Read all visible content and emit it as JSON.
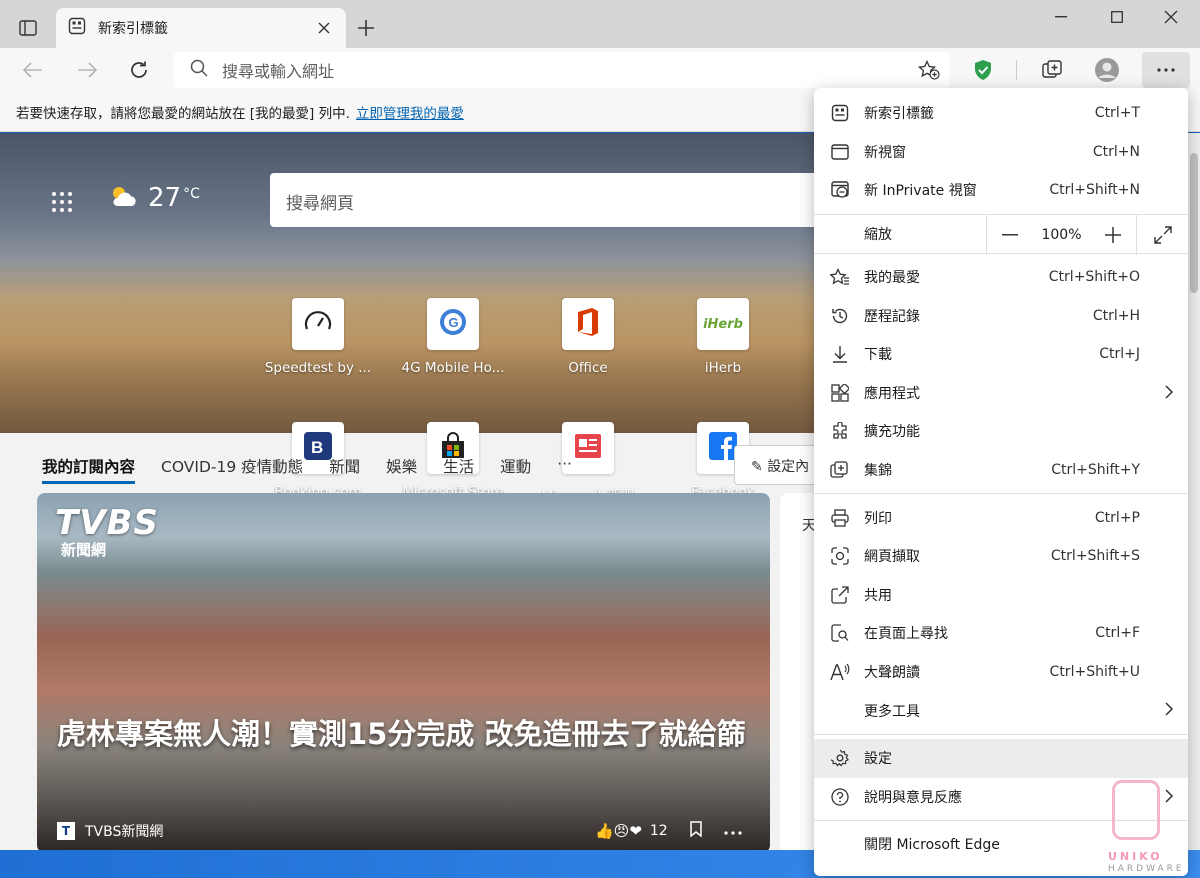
{
  "tab": {
    "title": "新索引標籤"
  },
  "omnibox": {
    "placeholder": "搜尋或輸入網址"
  },
  "favbar": {
    "hint": "若要快速存取，請將您最愛的網站放在 [我的最愛] 列中.",
    "link": "立即管理我的最愛"
  },
  "weather": {
    "temp": "27",
    "unit": "°C"
  },
  "search": {
    "placeholder": "搜尋網頁"
  },
  "tiles": [
    {
      "label": "Speedtest by ...",
      "icon": "speedometer-icon"
    },
    {
      "label": "4G Mobile Ho...",
      "icon": "globe-icon"
    },
    {
      "label": "Office",
      "icon": "office-icon"
    },
    {
      "label": "iHerb",
      "icon": "iherb-icon"
    },
    {
      "label": "Booking.com",
      "icon": "booking-icon"
    },
    {
      "label": "Microsoft Store",
      "icon": "store-icon"
    },
    {
      "label": "Microsoft 新聞",
      "icon": "news-icon"
    },
    {
      "label": "Facebook",
      "icon": "facebook-icon"
    }
  ],
  "feed": {
    "tabs": [
      "我的訂閱內容",
      "COVID-19 疫情動態",
      "新聞",
      "娛樂",
      "生活",
      "運動",
      "···"
    ],
    "settings": "設定內"
  },
  "news": {
    "logo": "TVBS",
    "logo_sub": "新聞網",
    "headline": "虎林專案無人潮！實測15分完成 改免造冊去了就給篩",
    "source": "TVBS新聞網",
    "source_logo": "T",
    "reactions": "12",
    "side_text": "天"
  },
  "menu": {
    "items1": [
      {
        "label": "新索引標籤",
        "shortcut": "Ctrl+T",
        "icon": "new-tab-icon"
      },
      {
        "label": "新視窗",
        "shortcut": "Ctrl+N",
        "icon": "new-window-icon"
      },
      {
        "label": "新 InPrivate 視窗",
        "shortcut": "Ctrl+Shift+N",
        "icon": "inprivate-icon"
      }
    ],
    "zoom": {
      "label": "縮放",
      "value": "100%"
    },
    "items2": [
      {
        "label": "我的最愛",
        "shortcut": "Ctrl+Shift+O",
        "icon": "favorites-icon"
      },
      {
        "label": "歷程記錄",
        "shortcut": "Ctrl+H",
        "icon": "history-icon"
      },
      {
        "label": "下載",
        "shortcut": "Ctrl+J",
        "icon": "download-icon"
      },
      {
        "label": "應用程式",
        "shortcut": "",
        "icon": "apps-icon",
        "submenu": true
      },
      {
        "label": "擴充功能",
        "shortcut": "",
        "icon": "extensions-icon"
      },
      {
        "label": "集錦",
        "shortcut": "Ctrl+Shift+Y",
        "icon": "collections-icon"
      }
    ],
    "items3": [
      {
        "label": "列印",
        "shortcut": "Ctrl+P",
        "icon": "print-icon"
      },
      {
        "label": "網頁擷取",
        "shortcut": "Ctrl+Shift+S",
        "icon": "capture-icon"
      },
      {
        "label": "共用",
        "shortcut": "",
        "icon": "share-icon"
      },
      {
        "label": "在頁面上尋找",
        "shortcut": "Ctrl+F",
        "icon": "find-icon"
      },
      {
        "label": "大聲朗讀",
        "shortcut": "Ctrl+Shift+U",
        "icon": "read-aloud-icon"
      },
      {
        "label": "更多工具",
        "shortcut": "",
        "icon": "",
        "submenu": true
      }
    ],
    "items4": [
      {
        "label": "設定",
        "shortcut": "",
        "icon": "gear-icon"
      },
      {
        "label": "說明與意見反應",
        "shortcut": "",
        "icon": "help-icon",
        "submenu": true
      }
    ],
    "close": {
      "label": "關閉 Microsoft Edge"
    }
  },
  "watermark": {
    "line1": "UNIKO",
    "line2": "HARDWARE"
  }
}
